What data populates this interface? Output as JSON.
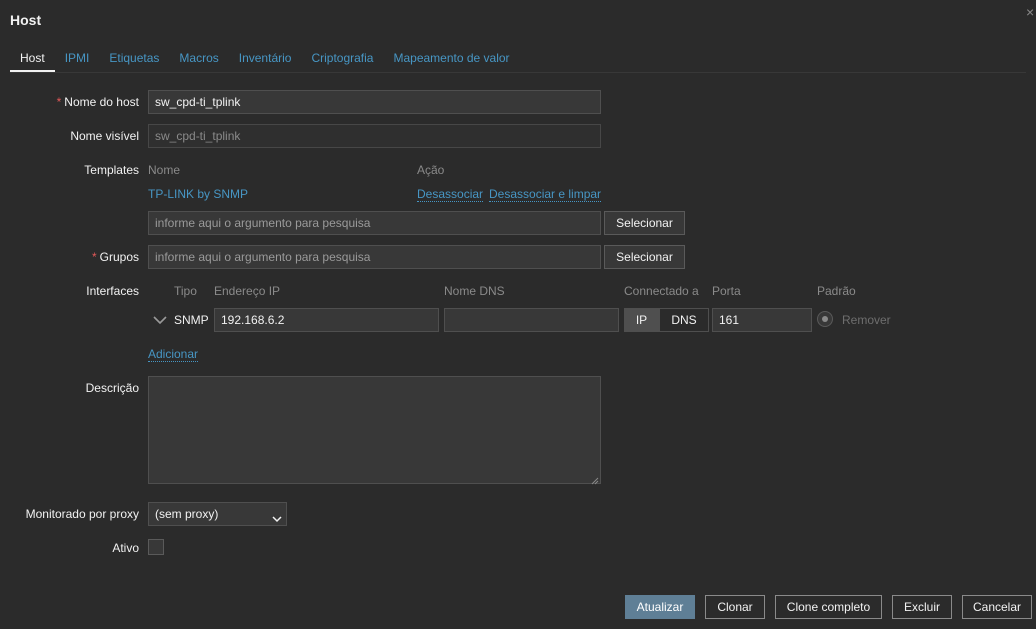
{
  "dialog": {
    "title": "Host",
    "close_icon": "×"
  },
  "tabs": [
    "Host",
    "IPMI",
    "Etiquetas",
    "Macros",
    "Inventário",
    "Criptografia",
    "Mapeamento de valor"
  ],
  "form": {
    "host_name_label": "Nome do host",
    "host_name_value": "sw_cpd-ti_tplink",
    "visible_name_label": "Nome visível",
    "visible_name_value": "sw_cpd-ti_tplink",
    "templates_label": "Templates",
    "templates_col_name": "Nome",
    "templates_col_action": "Ação",
    "template_item": "TP-LINK by SNMP",
    "unlink": "Desassociar",
    "unlink_clear": "Desassociar e limpar",
    "search_placeholder": "informe aqui o argumento para pesquisa",
    "select_button": "Selecionar",
    "groups_label": "Grupos",
    "interfaces_label": "Interfaces",
    "iface_headers": {
      "type": "Tipo",
      "ip": "Endereço IP",
      "dns": "Nome DNS",
      "connect": "Connectado a",
      "port": "Porta",
      "default": "Padrão"
    },
    "iface": {
      "type": "SNMP",
      "ip": "192.168.6.2",
      "dns": "",
      "connect_ip": "IP",
      "connect_dns": "DNS",
      "port": "161",
      "remove": "Remover"
    },
    "add_link": "Adicionar",
    "description_label": "Descrição",
    "description_value": "",
    "proxy_label": "Monitorado por proxy",
    "proxy_value": "(sem proxy)",
    "enabled_label": "Ativo",
    "required_mark": "*"
  },
  "footer": {
    "update": "Atualizar",
    "clone": "Clonar",
    "full_clone": "Clone completo",
    "delete": "Excluir",
    "cancel": "Cancelar"
  }
}
